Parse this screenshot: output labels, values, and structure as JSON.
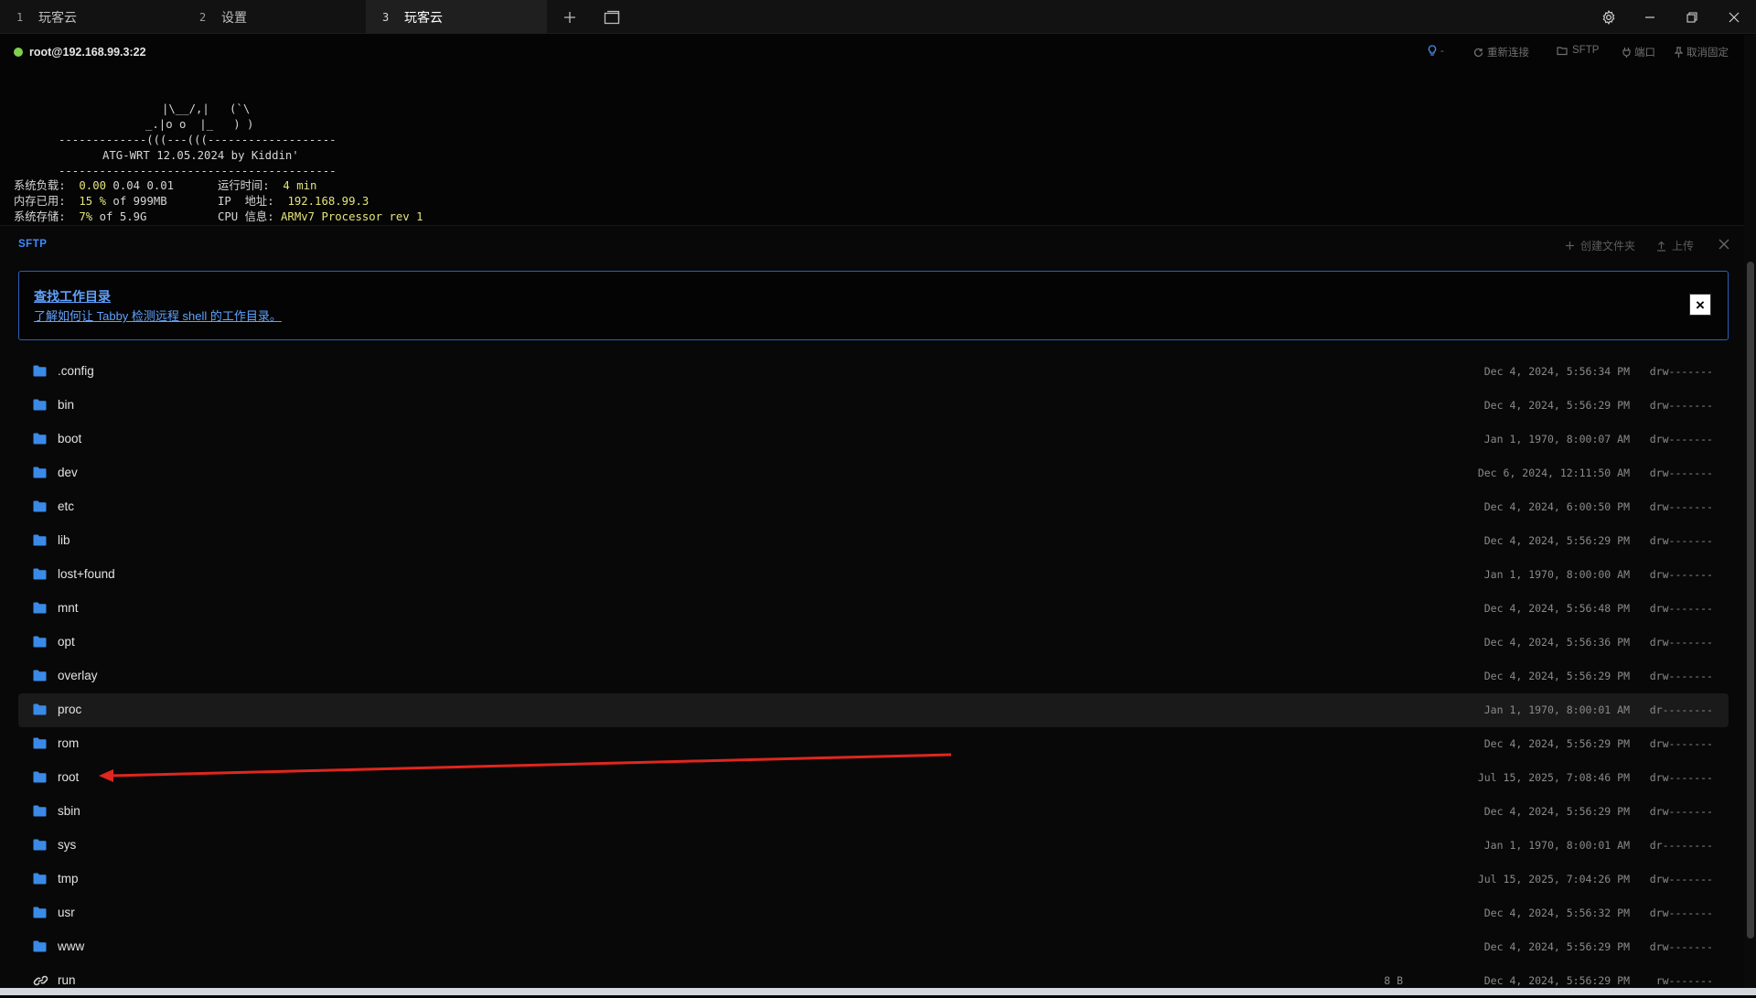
{
  "tabs": [
    {
      "num": "1",
      "label": "玩客云"
    },
    {
      "num": "2",
      "label": "设置"
    },
    {
      "num": "3",
      "label": "玩客云"
    }
  ],
  "header": {
    "connection": "root@192.168.99.3:22",
    "status_color": "#7fd04a",
    "bulb_suffix": "-",
    "reconnect": "重新连接",
    "sftp": "SFTP",
    "ports": "端口",
    "unpin": "取消固定"
  },
  "terminal": {
    "art1": "|\\__/,|   (`\\",
    "art2": "_.|o o  |_   ) )",
    "art3": "-------------(((---(((-------------------",
    "art4": "ATG-WRT 12.05.2024 by Kiddin'",
    "art5": "-----------------------------------------",
    "load_label": "系统负载:",
    "load_value": "0.00",
    "load_rest": " 0.04 0.01",
    "uptime_label": "运行时间:",
    "uptime_value": "4 min",
    "mem_label": "内存已用:",
    "mem_value": "15 %",
    "mem_rest": " of 999MB",
    "ip_label": "IP  地址:",
    "ip_value": "192.168.99.3",
    "disk_label": "系统存储:",
    "disk_value": "7%",
    "disk_rest": " of 5.9G",
    "cpu_label": "CPU 信息:",
    "cpu_value": "ARMv7 Processor rev 1"
  },
  "sftp": {
    "title": "SFTP",
    "create_folder": "创建文件夹",
    "upload": "上传",
    "banner_title": "查找工作目录",
    "banner_sub": "了解如何让 Tabby 检测远程 shell 的工作目录。",
    "accent": "#3d8bff",
    "files": [
      {
        "name": ".config",
        "size": "",
        "date": "Dec 4, 2024, 5:56:34 PM",
        "perm": "drw-------",
        "type": "folder"
      },
      {
        "name": "bin",
        "size": "",
        "date": "Dec 4, 2024, 5:56:29 PM",
        "perm": "drw-------",
        "type": "folder"
      },
      {
        "name": "boot",
        "size": "",
        "date": "Jan 1, 1970, 8:00:07 AM",
        "perm": "drw-------",
        "type": "folder"
      },
      {
        "name": "dev",
        "size": "",
        "date": "Dec 6, 2024, 12:11:50 AM",
        "perm": "drw-------",
        "type": "folder"
      },
      {
        "name": "etc",
        "size": "",
        "date": "Dec 4, 2024, 6:00:50 PM",
        "perm": "drw-------",
        "type": "folder"
      },
      {
        "name": "lib",
        "size": "",
        "date": "Dec 4, 2024, 5:56:29 PM",
        "perm": "drw-------",
        "type": "folder"
      },
      {
        "name": "lost+found",
        "size": "",
        "date": "Jan 1, 1970, 8:00:00 AM",
        "perm": "drw-------",
        "type": "folder"
      },
      {
        "name": "mnt",
        "size": "",
        "date": "Dec 4, 2024, 5:56:48 PM",
        "perm": "drw-------",
        "type": "folder"
      },
      {
        "name": "opt",
        "size": "",
        "date": "Dec 4, 2024, 5:56:36 PM",
        "perm": "drw-------",
        "type": "folder"
      },
      {
        "name": "overlay",
        "size": "",
        "date": "Dec 4, 2024, 5:56:29 PM",
        "perm": "drw-------",
        "type": "folder"
      },
      {
        "name": "proc",
        "size": "",
        "date": "Jan 1, 1970, 8:00:01 AM",
        "perm": "dr--------",
        "type": "folder",
        "highlight": true
      },
      {
        "name": "rom",
        "size": "",
        "date": "Dec 4, 2024, 5:56:29 PM",
        "perm": "drw-------",
        "type": "folder"
      },
      {
        "name": "root",
        "size": "",
        "date": "Jul 15, 2025, 7:08:46 PM",
        "perm": "drw-------",
        "type": "folder"
      },
      {
        "name": "sbin",
        "size": "",
        "date": "Dec 4, 2024, 5:56:29 PM",
        "perm": "drw-------",
        "type": "folder"
      },
      {
        "name": "sys",
        "size": "",
        "date": "Jan 1, 1970, 8:00:01 AM",
        "perm": "dr--------",
        "type": "folder"
      },
      {
        "name": "tmp",
        "size": "",
        "date": "Jul 15, 2025, 7:04:26 PM",
        "perm": "drw-------",
        "type": "folder"
      },
      {
        "name": "usr",
        "size": "",
        "date": "Dec 4, 2024, 5:56:32 PM",
        "perm": "drw-------",
        "type": "folder"
      },
      {
        "name": "www",
        "size": "",
        "date": "Dec 4, 2024, 5:56:29 PM",
        "perm": "drw-------",
        "type": "folder"
      },
      {
        "name": "run",
        "size": "8 B",
        "date": "Dec 4, 2024, 5:56:29 PM",
        "perm": "rw-------",
        "type": "link"
      }
    ]
  },
  "annotation": {
    "color": "#e0261e"
  }
}
